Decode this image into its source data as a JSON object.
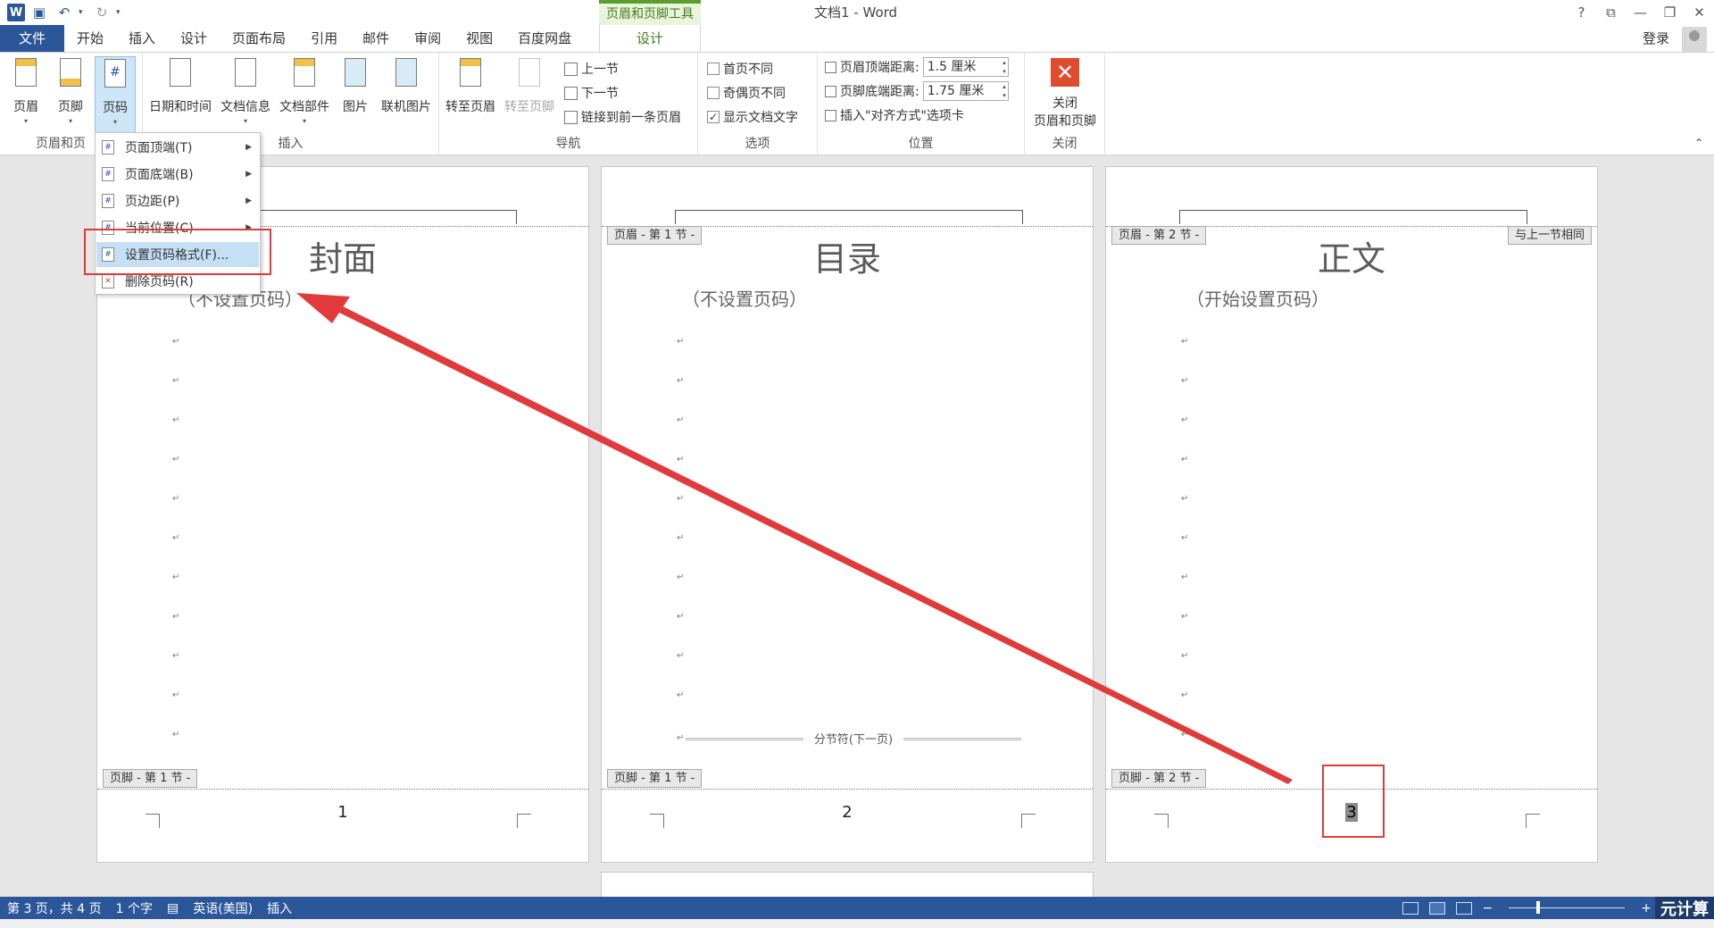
{
  "titlebar": {
    "app_title": "文档1 - Word",
    "context_tab_group": "页眉和页脚工具",
    "help": "?",
    "ribbon_display": "⧉",
    "minimize": "—",
    "restore": "❐",
    "close": "✕"
  },
  "tabs": [
    {
      "label": "文件"
    },
    {
      "label": "开始"
    },
    {
      "label": "插入"
    },
    {
      "label": "设计"
    },
    {
      "label": "页面布局"
    },
    {
      "label": "引用"
    },
    {
      "label": "邮件"
    },
    {
      "label": "审阅"
    },
    {
      "label": "视图"
    },
    {
      "label": "百度网盘"
    }
  ],
  "context_tab": "设计",
  "login": "登录",
  "ribbon": {
    "group_header_footer": {
      "label": "页眉和页",
      "header": "页眉",
      "footer": "页脚",
      "page_number": "页码"
    },
    "group_insert": {
      "label": "插入",
      "datetime": "日期和时间",
      "docinfo": "文档信息",
      "quickparts": "文档部件",
      "picture": "图片",
      "online_picture": "联机图片"
    },
    "group_nav": {
      "label": "导航",
      "goto_header": "转至页眉",
      "goto_footer": "转至页脚",
      "prev": "上一节",
      "next": "下一节",
      "link_prev": "链接到前一条页眉"
    },
    "group_options": {
      "label": "选项",
      "first_diff": "首页不同",
      "oddeven_diff": "奇偶页不同",
      "show_text": "显示文档文字",
      "checks": [
        false,
        false,
        true
      ]
    },
    "group_position": {
      "label": "位置",
      "header_dist_label": "页眉顶端距离:",
      "header_dist": "1.5 厘米",
      "footer_dist_label": "页脚底端距离:",
      "footer_dist": "1.75 厘米",
      "align_tab": "插入\"对齐方式\"选项卡"
    },
    "group_close": {
      "label": "关闭",
      "close_line1": "关闭",
      "close_line2": "页眉和页脚"
    }
  },
  "menu": {
    "items": [
      {
        "label": "页面顶端(T)",
        "submenu": true
      },
      {
        "label": "页面底端(B)",
        "submenu": true
      },
      {
        "label": "页边距(P)",
        "submenu": true
      },
      {
        "label": "当前位置(C)",
        "submenu": true
      },
      {
        "label": "设置页码格式(F)...",
        "submenu": false
      },
      {
        "label": "删除页码(R)",
        "submenu": false
      }
    ]
  },
  "pages": [
    {
      "title": "封面",
      "subtitle": "（不设置页码）",
      "header_tag": "",
      "footer_tag": "页脚 - 第 1 节 -",
      "number": "1"
    },
    {
      "title": "目录",
      "subtitle": "（不设置页码）",
      "header_tag": "页眉 - 第 1 节 -",
      "footer_tag": "页脚 - 第 1 节 -",
      "number": "2",
      "section_break": "分节符(下一页)"
    },
    {
      "title": "正文",
      "subtitle": "（开始设置页码）",
      "header_tag": "页眉 - 第 2 节 -",
      "same_as_prev": "与上一节相同",
      "footer_tag": "页脚 - 第 2 节 -",
      "number": "3"
    }
  ],
  "status": {
    "page": "第 3 页，共 4 页",
    "words": "1 个字",
    "language": "英语(美国)",
    "mode": "插入",
    "zoom_minus": "−",
    "zoom_plus": "+"
  },
  "watermark": "元计算",
  "colors": {
    "brand": "#2b579a",
    "context_green": "#5a9e2f",
    "annotation_red": "#e03a3a"
  }
}
